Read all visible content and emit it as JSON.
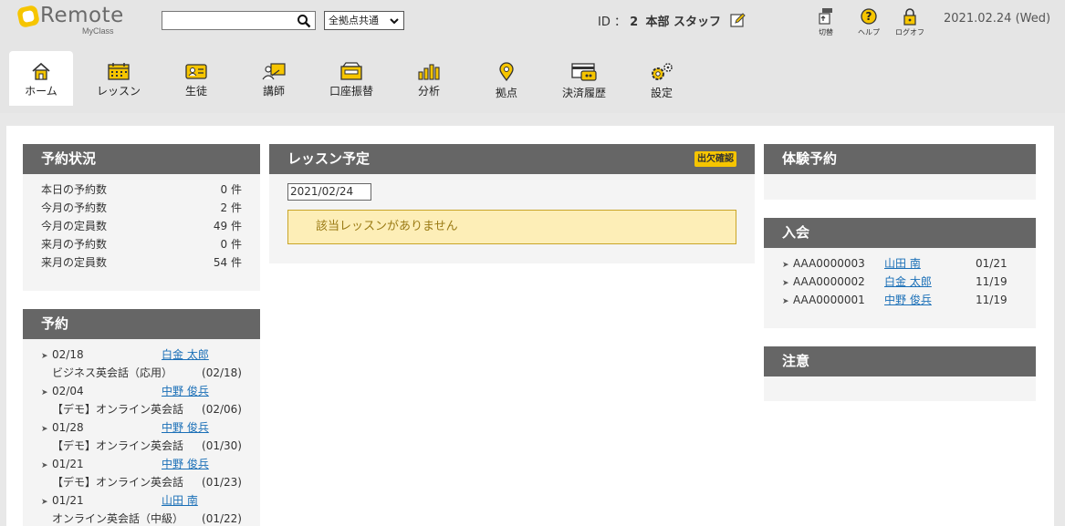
{
  "header": {
    "logo": "Remote",
    "logo_sub": "MyClass",
    "search_placeholder": "",
    "site_select": "全拠点共通",
    "id_label": "ID ：",
    "id_value": "2",
    "user_name": "本部 スタッフ",
    "tools": [
      {
        "label": "切替",
        "icon": "switch-icon"
      },
      {
        "label": "ヘルプ",
        "icon": "help-icon"
      },
      {
        "label": "ログオフ",
        "icon": "lock-icon"
      }
    ],
    "date": "2021.02.24 (Wed)"
  },
  "nav": [
    {
      "label": "ホーム",
      "icon": "home-icon",
      "active": true
    },
    {
      "label": "レッスン",
      "icon": "calendar-icon"
    },
    {
      "label": "生徒",
      "icon": "id-card-icon"
    },
    {
      "label": "講師",
      "icon": "teacher-icon"
    },
    {
      "label": "口座振替",
      "icon": "cash-register-icon"
    },
    {
      "label": "分析",
      "icon": "bar-chart-icon"
    },
    {
      "label": "拠点",
      "icon": "map-pin-icon"
    },
    {
      "label": "決済履歴",
      "icon": "payment-history-icon"
    },
    {
      "label": "設定",
      "icon": "gear-icon"
    }
  ],
  "reservation_status": {
    "title": "予約状況",
    "rows": [
      {
        "label": "本日の予約数",
        "value": "0 件"
      },
      {
        "label": "今月の予約数",
        "value": "2 件"
      },
      {
        "label": "今月の定員数",
        "value": "49 件"
      },
      {
        "label": "来月の予約数",
        "value": "0 件"
      },
      {
        "label": "来月の定員数",
        "value": "54 件"
      }
    ]
  },
  "reservations": {
    "title": "予約",
    "items": [
      {
        "date": "02/18",
        "name": "白金 太郎",
        "course": "ビジネス英会話（応用）",
        "course_date": "(02/18)"
      },
      {
        "date": "02/04",
        "name": "中野 俊兵",
        "course": "【デモ】オンライン英会話",
        "course_date": "(02/06)"
      },
      {
        "date": "01/28",
        "name": "中野 俊兵",
        "course": "【デモ】オンライン英会話",
        "course_date": "(01/30)"
      },
      {
        "date": "01/21",
        "name": "中野 俊兵",
        "course": "【デモ】オンライン英会話",
        "course_date": "(01/23)"
      },
      {
        "date": "01/21",
        "name": "山田 南",
        "course": "オンライン英会話（中級）",
        "course_date": "(01/22)"
      }
    ]
  },
  "lessons": {
    "title": "レッスン予定",
    "badge": "出欠確認",
    "date_value": "2021/02/24",
    "empty_message": "該当レッスンがありません"
  },
  "trial": {
    "title": "体験予約"
  },
  "enrollment": {
    "title": "入会",
    "rows": [
      {
        "id": "AAA0000003",
        "name": "山田 南",
        "date": "01/21"
      },
      {
        "id": "AAA0000002",
        "name": "白金 太郎",
        "date": "11/19"
      },
      {
        "id": "AAA0000001",
        "name": "中野 俊兵",
        "date": "11/19"
      }
    ]
  },
  "notes": {
    "title": "注意"
  },
  "colors": {
    "accent": "#f6c500",
    "panel_header": "#666666",
    "link": "#1a6fb7",
    "notice_bg": "#fdeeb7"
  }
}
